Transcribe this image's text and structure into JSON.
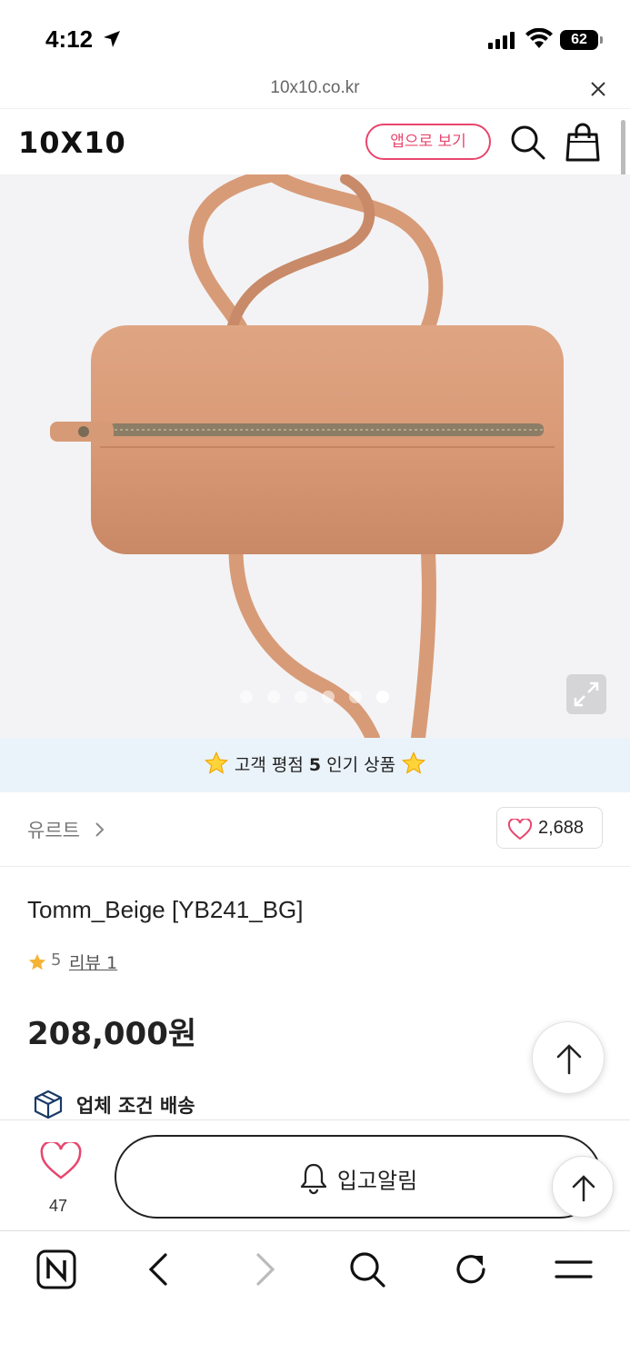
{
  "status_bar": {
    "time": "4:12",
    "battery": "62",
    "icons": [
      "location-arrow-icon",
      "signal-icon",
      "wifi-icon",
      "battery-icon"
    ]
  },
  "url_bar": {
    "url": "10x10.co.kr",
    "close_icon": "close-icon"
  },
  "header": {
    "logo": "10X10",
    "app_button_label": "앱으로 보기",
    "icons": [
      "search-icon",
      "shopping-bag-icon"
    ],
    "accent_color": "#e8466e"
  },
  "gallery": {
    "slide_count": 6,
    "active_slide": 6,
    "expand_icon": "expand-icon"
  },
  "rating_banner": {
    "prefix": "고객 평점 ",
    "score": "5",
    "suffix": " 인기 상품",
    "icon": "star-icon"
  },
  "brand": {
    "name": "유르트",
    "like_count": "2,688"
  },
  "product": {
    "title": "Tomm_Beige [YB241_BG]",
    "rating": "5",
    "review_link": "리뷰 1",
    "price": "208,000원",
    "shipping": "업체 조건 배송"
  },
  "purchase_bar": {
    "wish_count": "47",
    "notify_label": "입고알림",
    "icons": [
      "heart-icon",
      "bell-icon",
      "arrow-up-icon"
    ]
  },
  "browser_toolbar": {
    "icons": [
      "naver-home-icon",
      "back-icon",
      "forward-icon",
      "search-icon",
      "refresh-icon",
      "menu-icon"
    ]
  }
}
